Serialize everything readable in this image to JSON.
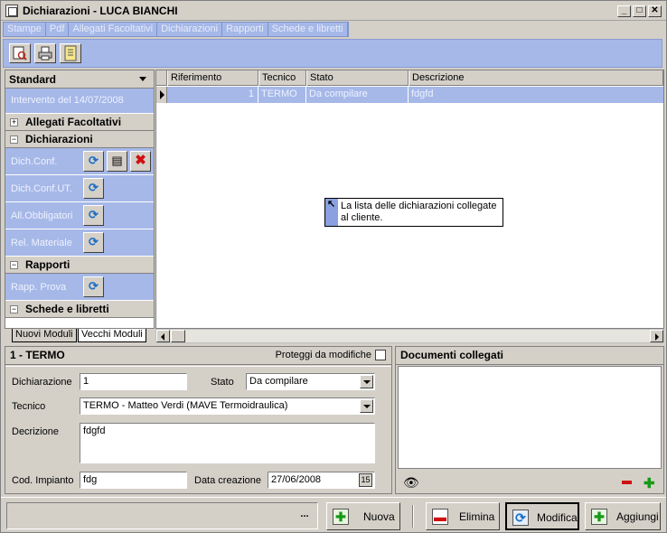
{
  "window": {
    "title": "Dichiarazioni - LUCA BIANCHI",
    "min": "_",
    "max": "□",
    "close": "✕"
  },
  "menu": [
    "Stampe",
    "Pdf",
    "Allegati Facoltativi",
    "Dichiarazioni",
    "Rapporti",
    "Schede e libretti"
  ],
  "toolbar": {
    "icons": [
      "preview-icon",
      "print-icon",
      "document-icon"
    ]
  },
  "sidebar": {
    "header": "Standard",
    "top_item": "Intervento del 14/07/2008",
    "groups": {
      "allegati": {
        "title": "Allegati Facoltativi",
        "toggle": "+"
      },
      "dichiarazioni": {
        "title": "Dichiarazioni",
        "toggle": "−"
      },
      "rapporti": {
        "title": "Rapporti",
        "toggle": "−"
      },
      "schede": {
        "title": "Schede e libretti",
        "toggle": "−"
      }
    },
    "items": {
      "dich_conf": "Dich.Conf.",
      "dich_conf_ut": "Dich.Conf.UT.",
      "all_obbligatori": "All.Obbligatori",
      "rel_materiale": "Rel. Materiale",
      "rapp_prova": "Rapp. Prova"
    },
    "tabs": [
      "Nuovi Moduli",
      "Vecchi Moduli"
    ]
  },
  "grid": {
    "columns": [
      "Riferimento",
      "Tecnico",
      "Stato",
      "Descrizione"
    ],
    "rows": [
      {
        "riferimento": "1",
        "tecnico": "TERMO",
        "stato": "Da compilare",
        "descrizione": "fdgfd"
      }
    ],
    "tooltip": "La lista delle dichiarazioni collegate al cliente."
  },
  "detail": {
    "title": "1 - TERMO",
    "protect_label": "Proteggi da modifiche",
    "labels": {
      "dichiarazione": "Dichiarazione",
      "stato": "Stato",
      "tecnico": "Tecnico",
      "descrizione": "Decrizione",
      "cod_impianto": "Cod. Impianto",
      "data_creazione": "Data creazione"
    },
    "values": {
      "dichiarazione": "1",
      "stato": "Da compilare",
      "tecnico": "TERMO - Matteo Verdi (MAVE Termoidraulica)",
      "descrizione": "fdgfd",
      "cod_impianto": "fdg",
      "data_creazione": "27/06/2008",
      "calendar": "15"
    }
  },
  "documents": {
    "title": "Documenti collegati"
  },
  "status": {
    "ellipsis": "..."
  },
  "buttons": {
    "nuova": "Nuova",
    "elimina": "Elimina",
    "modifica": "Modifica",
    "aggiungi": "Aggiungi"
  }
}
